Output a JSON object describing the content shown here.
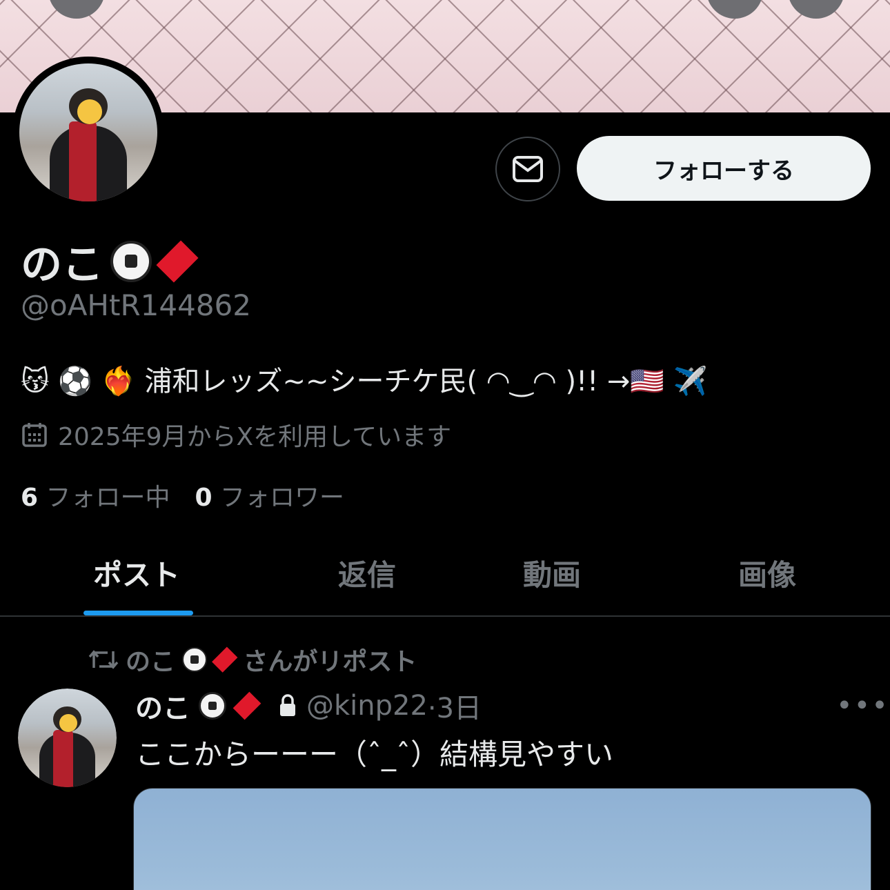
{
  "profile": {
    "display_name": "のこ",
    "handle": "@oAHtR144862",
    "bio": "😽 ⚽ ❤️‍🔥 浦和レッズ~~シーチケ民( ◠‿◠ )!! →🇺🇸 ✈️",
    "joined": "2025年9月からXを利用しています",
    "following_count": "6",
    "following_label": "フォロー中",
    "followers_count": "0",
    "followers_label": "フォロワー"
  },
  "actions": {
    "follow_label": "フォローする"
  },
  "tabs": [
    "ポスト",
    "返信",
    "動画",
    "画像"
  ],
  "feed": {
    "repost_by": "のこ",
    "repost_suffix": "さんがリポスト",
    "tweet": {
      "author_name": "のこ",
      "author_handle": "@kinp22",
      "time": "·3日",
      "text": "ここからーーー（ˆ_ˆ）結構見やすい"
    }
  },
  "icons": {
    "message": "envelope-icon",
    "calendar": "calendar-icon",
    "repost": "repost-icon",
    "lock": "lock-icon",
    "more": "more-icon"
  },
  "colors": {
    "accent": "#1d9bf0",
    "background": "#000000",
    "muted": "#71767b",
    "follow_button": "#eff3f4"
  }
}
